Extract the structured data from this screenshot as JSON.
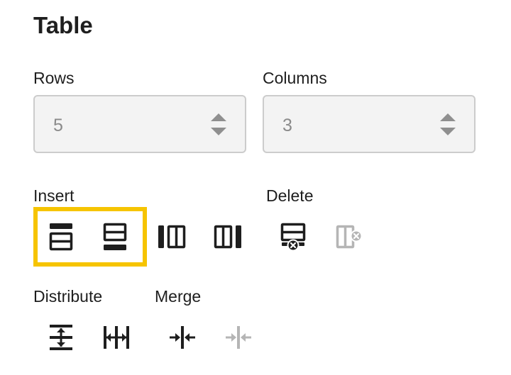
{
  "panel": {
    "title": "Table"
  },
  "fields": {
    "rows": {
      "label": "Rows",
      "value": "5"
    },
    "columns": {
      "label": "Columns",
      "value": "3"
    }
  },
  "sections": {
    "insert": "Insert",
    "delete": "Delete",
    "distribute": "Distribute",
    "merge": "Merge"
  },
  "tools": {
    "insert": [
      {
        "icon": "insert-row-above-icon",
        "enabled": true,
        "highlighted": true
      },
      {
        "icon": "insert-row-below-icon",
        "enabled": true,
        "highlighted": true
      },
      {
        "icon": "insert-column-left-icon",
        "enabled": true
      },
      {
        "icon": "insert-column-right-icon",
        "enabled": true
      }
    ],
    "delete": [
      {
        "icon": "delete-row-icon",
        "enabled": true
      },
      {
        "icon": "delete-column-icon",
        "enabled": false
      }
    ],
    "distribute": [
      {
        "icon": "distribute-rows-icon",
        "enabled": true
      },
      {
        "icon": "distribute-columns-icon",
        "enabled": true
      }
    ],
    "merge": [
      {
        "icon": "merge-cells-icon",
        "enabled": true
      },
      {
        "icon": "split-cells-icon",
        "enabled": false
      }
    ]
  },
  "colors": {
    "icon": "#1e1e1e",
    "icon_disabled": "#b5b5b5",
    "highlight": "#f6c400",
    "field_bg": "#f3f3f3",
    "field_border": "#cccccc"
  }
}
